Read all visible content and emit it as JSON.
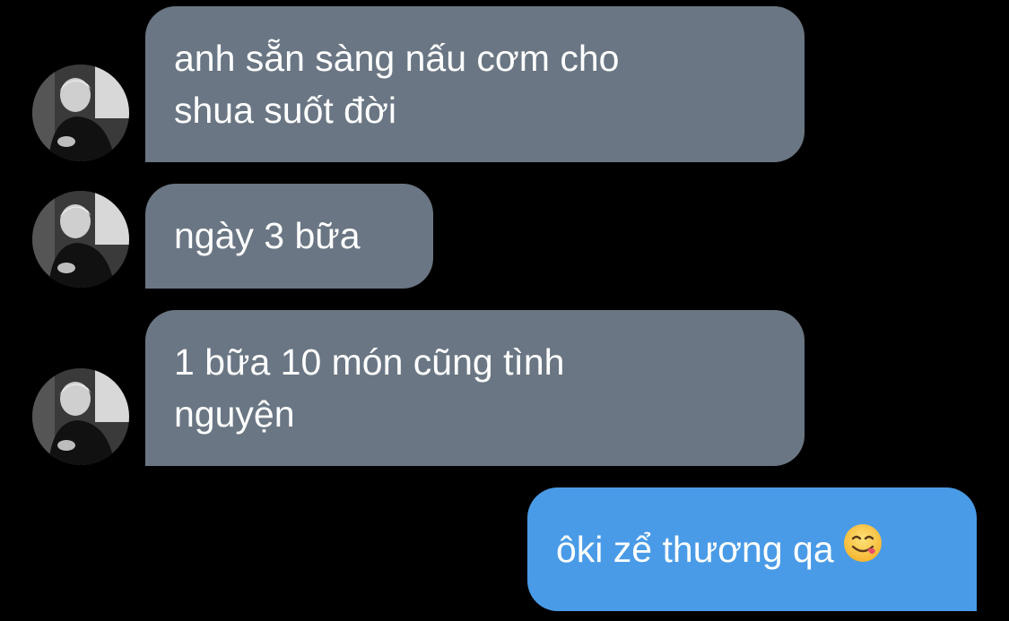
{
  "messages": [
    {
      "direction": "incoming",
      "lines": [
        "anh sẵn sàng nấu cơm cho",
        "shua suốt đời"
      ]
    },
    {
      "direction": "incoming",
      "lines": [
        "ngày 3 bữa"
      ]
    },
    {
      "direction": "incoming",
      "lines": [
        "1 bữa 10 món cũng tình",
        "nguyện"
      ]
    },
    {
      "direction": "outgoing",
      "lines": [
        "ôki zể thương qa"
      ],
      "emoji": "face-savoring-food-emoji"
    }
  ],
  "colors": {
    "background": "#000000",
    "incoming_bubble": "#6a7683",
    "outgoing_bubble": "#4a9be7",
    "text": "#ffffff"
  }
}
